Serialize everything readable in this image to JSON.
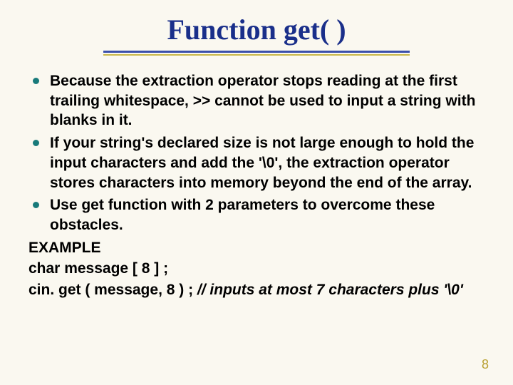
{
  "title": "Function get( )",
  "bullets": [
    "Because the extraction operator stops reading at the first trailing whitespace,  >> cannot be used to input a string with blanks in it.",
    "If your string's declared size is not large enough to hold the input characters and add the '\\0', the extraction operator stores characters into memory beyond the end of the array.",
    "Use get function with 2 parameters to overcome these obstacles."
  ],
  "example_label": "EXAMPLE",
  "code_line1": "char  message [ 8 ] ;",
  "code_line2_code": "cin. get ( message, 8 ) ;  ",
  "code_line2_comment": "// inputs at most 7 characters plus '\\0'",
  "page_number": "8"
}
